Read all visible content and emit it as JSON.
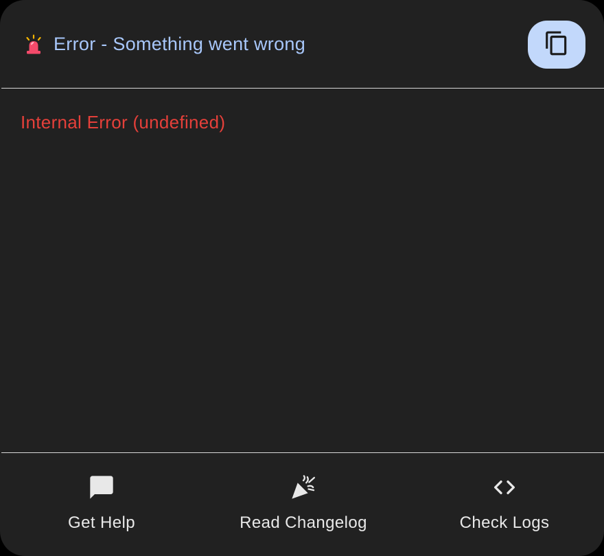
{
  "theme": {
    "surface": "#212121",
    "title_color": "#a8c7fa",
    "error_color": "#e5403a",
    "label_color": "#e8e8e8",
    "copy_button_bg": "#c2d8fb",
    "copy_icon_color": "#1b1b1b",
    "siren_body": "#f44a6a",
    "siren_rays": "#f5b400"
  },
  "header": {
    "icon": "siren-icon",
    "title": "Error - Something went wrong",
    "copy_button_icon": "copy-icon"
  },
  "body": {
    "message": "Internal Error (undefined)"
  },
  "footer": {
    "actions": [
      {
        "icon": "chat-bubble-icon",
        "label": "Get Help"
      },
      {
        "icon": "party-popper-icon",
        "label": "Read Changelog"
      },
      {
        "icon": "code-brackets-icon",
        "label": "Check Logs"
      }
    ]
  }
}
